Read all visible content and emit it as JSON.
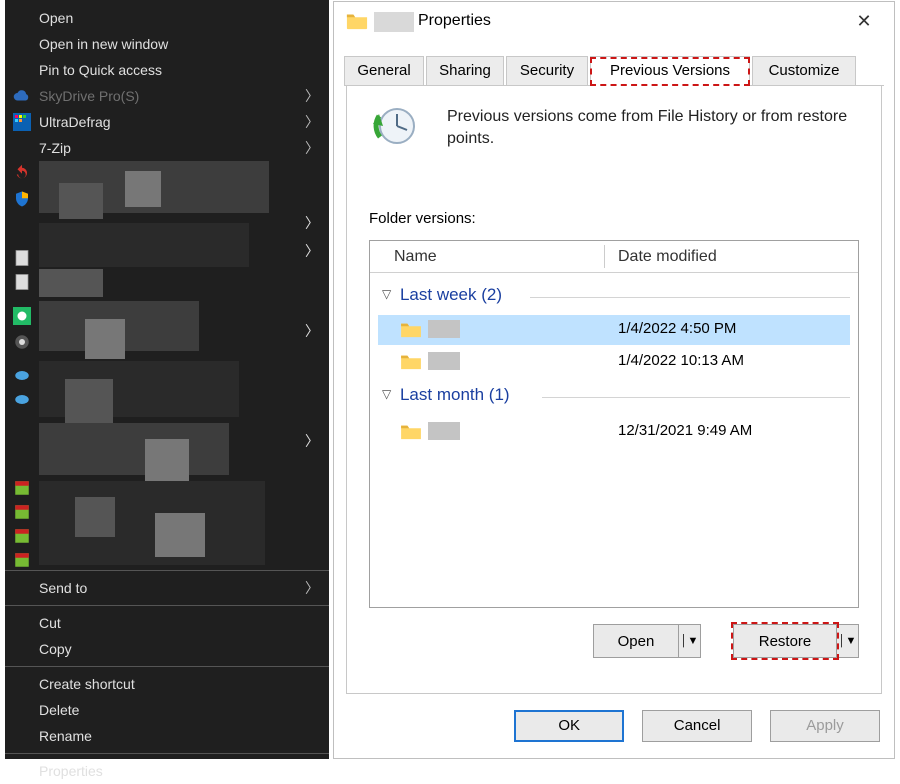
{
  "context_menu": {
    "open": "Open",
    "open_new": "Open in new window",
    "pin": "Pin to Quick access",
    "skydrive": "SkyDrive Pro(S)",
    "ultradefrag": "UltraDefrag",
    "sevenzip": "7-Zip",
    "sendto": "Send to",
    "cut": "Cut",
    "copy": "Copy",
    "create_sc": "Create shortcut",
    "delete": "Delete",
    "rename": "Rename",
    "props": "Properties"
  },
  "dialog": {
    "title_suffix": "Properties",
    "tabs": {
      "general": "General",
      "sharing": "Sharing",
      "security": "Security",
      "previous": "Previous Versions",
      "customize": "Customize"
    },
    "description": "Previous versions come from File History or from restore points.",
    "list_label": "Folder versions:",
    "columns": {
      "name": "Name",
      "date": "Date modified"
    },
    "groups": {
      "last_week": "Last week (2)",
      "last_month": "Last month (1)"
    },
    "rows": [
      {
        "date": "1/4/2022 4:50 PM"
      },
      {
        "date": "1/4/2022 10:13 AM"
      },
      {
        "date": "12/31/2021 9:49 AM"
      }
    ],
    "buttons": {
      "open": "Open",
      "restore": "Restore",
      "ok": "OK",
      "cancel": "Cancel",
      "apply": "Apply"
    }
  }
}
